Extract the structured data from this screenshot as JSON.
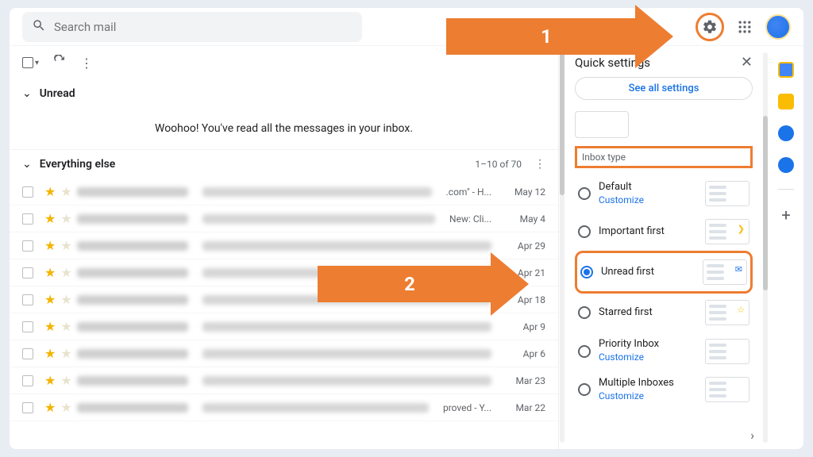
{
  "search": {
    "placeholder": "Search mail"
  },
  "annotations": {
    "arrow1": "1",
    "arrow2": "2"
  },
  "inbox": {
    "sections": {
      "unread": {
        "title": "Unread",
        "empty_message": "Woohoo! You've read all the messages in your inbox."
      },
      "everything": {
        "title": "Everything else",
        "range": "1–10 of 70"
      }
    },
    "rows": [
      {
        "date": "May 12",
        "snippet": ".com\" - H..."
      },
      {
        "date": "May 4",
        "snippet": "New: Cli..."
      },
      {
        "date": "Apr 29",
        "snippet": ""
      },
      {
        "date": "Apr 21",
        "snippet": ""
      },
      {
        "date": "Apr 18",
        "snippet": ""
      },
      {
        "date": "Apr 9",
        "snippet": ""
      },
      {
        "date": "Apr 6",
        "snippet": ""
      },
      {
        "date": "Mar 23",
        "snippet": ""
      },
      {
        "date": "Mar 22",
        "snippet": "proved - Y..."
      }
    ]
  },
  "panel": {
    "title": "Quick settings",
    "see_all": "See all settings",
    "section_label": "Inbox type",
    "options": [
      {
        "label": "Default",
        "sub": "Customize",
        "selected": false,
        "highlighted": false,
        "marker": ""
      },
      {
        "label": "Important first",
        "sub": "",
        "selected": false,
        "highlighted": false,
        "marker": "❯"
      },
      {
        "label": "Unread first",
        "sub": "",
        "selected": true,
        "highlighted": true,
        "marker": "✉"
      },
      {
        "label": "Starred first",
        "sub": "",
        "selected": false,
        "highlighted": false,
        "marker": "☆"
      },
      {
        "label": "Priority Inbox",
        "sub": "Customize",
        "selected": false,
        "highlighted": false,
        "marker": ""
      },
      {
        "label": "Multiple Inboxes",
        "sub": "Customize",
        "selected": false,
        "highlighted": false,
        "marker": ""
      }
    ]
  },
  "colors": {
    "accent": "#ed7d31",
    "link": "#1a73e8"
  }
}
